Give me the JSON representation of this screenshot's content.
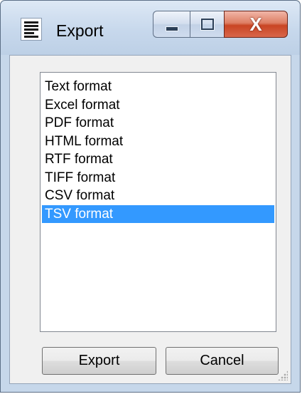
{
  "window": {
    "title": "Export",
    "icon": "document-lines-icon",
    "controls": {
      "minimize_icon": "minimize-icon",
      "maximize_icon": "maximize-icon",
      "close_glyph": "X"
    }
  },
  "format_list": {
    "items": [
      {
        "label": "Text format"
      },
      {
        "label": "Excel format"
      },
      {
        "label": "PDF format"
      },
      {
        "label": "HTML format"
      },
      {
        "label": "RTF format"
      },
      {
        "label": "TIFF format"
      },
      {
        "label": "CSV format"
      },
      {
        "label": "TSV format"
      }
    ],
    "selected_index": 7,
    "selection_color": "#3399ff"
  },
  "actions": {
    "export_label": "Export",
    "cancel_label": "Cancel"
  }
}
